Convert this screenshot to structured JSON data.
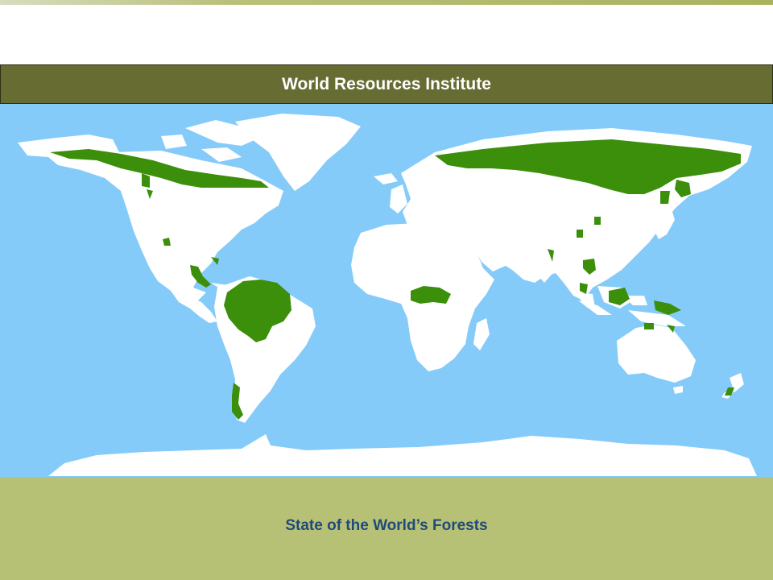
{
  "header": {
    "title": "World Resources Institute"
  },
  "footer": {
    "caption": "State of the World’s Forests"
  },
  "map": {
    "ocean_color": "#85cbf9",
    "land_color": "#ffffff",
    "forest_color": "#3b8f0a"
  }
}
